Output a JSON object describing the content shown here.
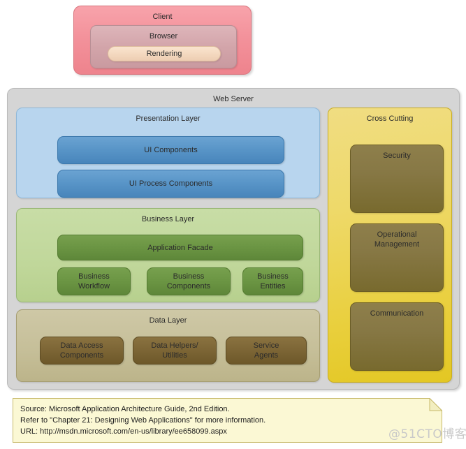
{
  "client": {
    "title": "Client",
    "browser": {
      "title": "Browser",
      "rendering": "Rendering"
    }
  },
  "web_server": {
    "title": "Web Server",
    "presentation_layer": {
      "title": "Presentation Layer",
      "components": [
        {
          "label": "UI Components"
        },
        {
          "label": "UI Process Components"
        }
      ]
    },
    "business_layer": {
      "title": "Business Layer",
      "facade": "Application Facade",
      "components": [
        {
          "label": "Business\nWorkflow"
        },
        {
          "label": "Business\nComponents"
        },
        {
          "label": "Business\nEntities"
        }
      ]
    },
    "data_layer": {
      "title": "Data Layer",
      "components": [
        {
          "label": "Data Access\nComponents"
        },
        {
          "label": "Data Helpers/\nUtilities"
        },
        {
          "label": "Service\nAgents"
        }
      ]
    },
    "cross_cutting": {
      "title": "Cross Cutting",
      "components": [
        {
          "label": "Security"
        },
        {
          "label": "Operational\nManagement"
        },
        {
          "label": "Communication"
        }
      ]
    }
  },
  "source_note": {
    "line1": "Source: Microsoft Application Architecture Guide, 2nd Edition.",
    "line2": "Refer to \"Chapter 21: Designing Web Applications\" for more information.",
    "line3": "URL: http://msdn.microsoft.com/en-us/library/ee658099.aspx"
  },
  "watermark": "@51CTO博客",
  "colors": {
    "client": "#f3929b",
    "browser": "#d3a5aa",
    "rendering": "#f4d9c0",
    "web_server": "#d5d5d5",
    "presentation_layer": "#b8d5ee",
    "presentation_component": "#5b97c9",
    "business_layer": "#c0d79a",
    "business_component": "#6c9644",
    "data_layer": "#c6bf99",
    "data_component": "#7c6535",
    "cross_cutting": "#eed969",
    "cross_cutting_component": "#877845",
    "note_background": "#fbf8d4"
  }
}
